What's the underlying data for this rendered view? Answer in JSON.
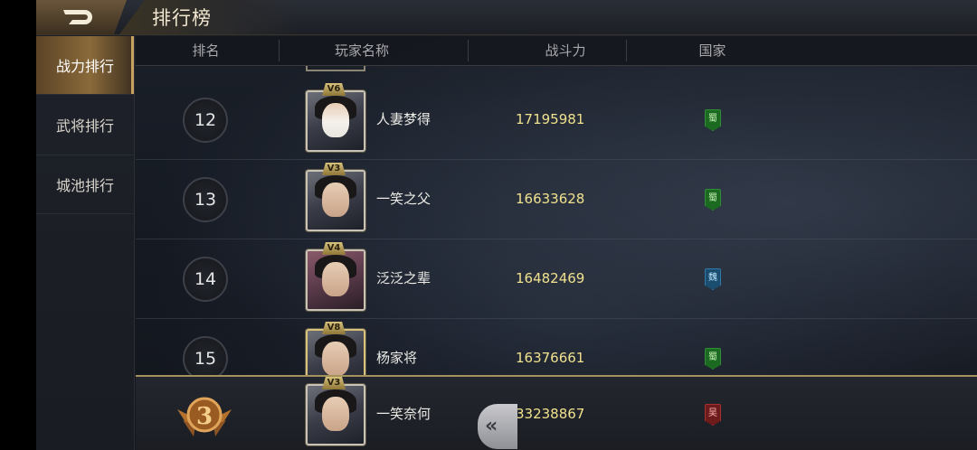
{
  "header": {
    "title": "排行榜",
    "back_icon": "back-arrow-icon"
  },
  "sidebar": {
    "items": [
      {
        "label": "战力排行",
        "active": true
      },
      {
        "label": "武将排行",
        "active": false
      },
      {
        "label": "城池排行",
        "active": false
      }
    ]
  },
  "columns": {
    "rank": "排名",
    "player": "玩家名称",
    "power": "战斗力",
    "country": "国家"
  },
  "rows": [
    {
      "rank": "12",
      "vip": "V6",
      "name": "人妻梦得",
      "power": "17195981",
      "country": "蜀",
      "country_color": "#1c6a22"
    },
    {
      "rank": "13",
      "vip": "V3",
      "name": "一笑之父",
      "power": "16633628",
      "country": "蜀",
      "country_color": "#1c6a22"
    },
    {
      "rank": "14",
      "vip": "V4",
      "name": "泛泛之辈",
      "power": "16482469",
      "country": "魏",
      "country_color": "#1b4d6e"
    },
    {
      "rank": "15",
      "vip": "V8",
      "name": "杨家将",
      "power": "16376661",
      "country": "蜀",
      "country_color": "#1c6a22"
    }
  ],
  "my_rank": {
    "rank": "3",
    "vip": "V3",
    "name": "一笑奈何",
    "power": "33238867",
    "country": "吴",
    "country_color": "#6e1b1b"
  },
  "colors": {
    "accent_gold": "#c8a060",
    "power_text": "#f0e28e"
  }
}
